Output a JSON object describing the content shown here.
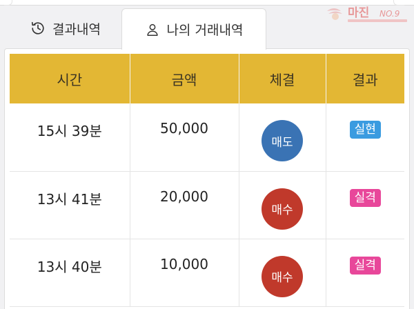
{
  "tabs": [
    {
      "label": "결과내역",
      "icon": "history-icon",
      "active": false
    },
    {
      "label": "나의 거래내역",
      "icon": "user-icon",
      "active": true
    }
  ],
  "watermark": {
    "text": "마진",
    "suffix": "NO.9"
  },
  "table": {
    "headers": [
      "시간",
      "금액",
      "체결",
      "결과"
    ],
    "rows": [
      {
        "time": "15시 39분",
        "amount": "50,000",
        "execution": "매도",
        "result": "실현"
      },
      {
        "time": "13시 41분",
        "amount": "20,000",
        "execution": "매수",
        "result": "실격"
      },
      {
        "time": "13시 40분",
        "amount": "10,000",
        "execution": "매수",
        "result": "실격"
      }
    ]
  },
  "colors": {
    "header_bg": "#e3b734",
    "sell": "#3a73b4",
    "buy": "#c0392b",
    "realized": "#3a9be0",
    "disqualified": "#e8479a"
  }
}
